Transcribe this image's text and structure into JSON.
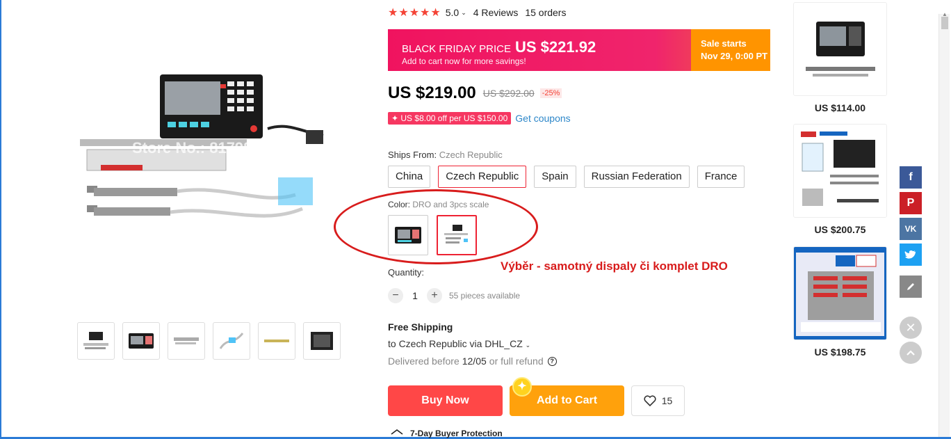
{
  "gallery": {
    "watermark": "Store No.: 817985",
    "thumbnails": [
      "scale-kit",
      "dro-display",
      "scale-bar",
      "cables",
      "long-scale",
      "dro-back"
    ]
  },
  "product": {
    "rating": "5.0",
    "reviews": "4 Reviews",
    "orders": "15 orders",
    "banner": {
      "label": "BLACK FRIDAY PRICE",
      "price": "US $221.92",
      "sub": "Add to cart now for more savings!",
      "sale_title": "Sale starts",
      "sale_date": "Nov 29, 0:00 PT"
    },
    "price": "US $219.00",
    "old_price": "US $292.00",
    "discount": "-25%",
    "coupon": "✦ US $8.00 off per US $150.00",
    "get_coupons": "Get coupons",
    "ships_from_label": "Ships From:",
    "ships_from_value": "Czech Republic",
    "ship_options": [
      "China",
      "Czech Republic",
      "Spain",
      "Russian Federation",
      "France"
    ],
    "color_label": "Color:",
    "color_value": "DRO and 3pcs scale",
    "annotation": "Výběr - samotný dispaly či komplet DRO",
    "quantity_label": "Quantity:",
    "quantity": "1",
    "available": "55 pieces available",
    "free_shipping": "Free Shipping",
    "ship_to": "to Czech Republic via DHL_CZ",
    "delivered_prefix": "Delivered before",
    "delivered_date": "12/05",
    "delivered_suffix": "or full refund",
    "buy_now": "Buy Now",
    "add_to_cart": "Add to Cart",
    "wishlist_count": "15",
    "protection": "7-Day Buyer Protection"
  },
  "recommendations": [
    {
      "price": "US $114.00"
    },
    {
      "price": "US $200.75"
    },
    {
      "price": "US $198.75"
    }
  ],
  "colors": {
    "accent_red": "#ff4747",
    "orange": "#ffa10c",
    "banner_pink": "#f0135f",
    "link_blue": "#2d87c9",
    "annotation_red": "#d81c1c"
  },
  "icons": {
    "facebook": "f",
    "pinterest": "P",
    "vk": "VK",
    "twitter": "twitter-bird",
    "edit": "pencil",
    "close": "✕",
    "up": "chevron-up"
  }
}
